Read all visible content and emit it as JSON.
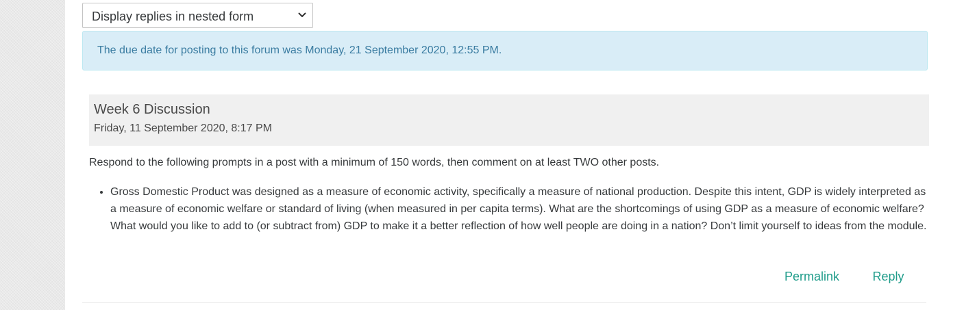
{
  "display_mode": {
    "selected": "Display replies in nested form",
    "chevron_icon": "chevron-down-icon"
  },
  "notice": {
    "text": "The due date for posting to this forum was Monday, 21 September 2020, 12:55 PM.",
    "background": "#d9edf7",
    "text_color": "#3a7ca1"
  },
  "post": {
    "title": "Week 6 Discussion",
    "date": "Friday, 11 September 2020, 8:17 PM",
    "intro": "Respond to the following prompts in a post with a minimum of 150 words, then comment on at least TWO other posts.",
    "bullets": [
      "Gross Domestic Product was designed as a measure of economic activity, specifically a measure of national production. Despite this intent, GDP is widely interpreted as a measure of economic welfare or standard of living (when measured in per capita terms). What are the shortcomings of using GDP as a measure of economic welfare? What would you like to add to (or subtract from) GDP to make it a better reflection of how well people are doing in a nation? Don’t limit yourself to ideas from the module."
    ],
    "actions": {
      "permalink": "Permalink",
      "reply": "Reply"
    }
  },
  "colors": {
    "link": "#1f9c8a",
    "header_bg": "#f0f0f0"
  }
}
